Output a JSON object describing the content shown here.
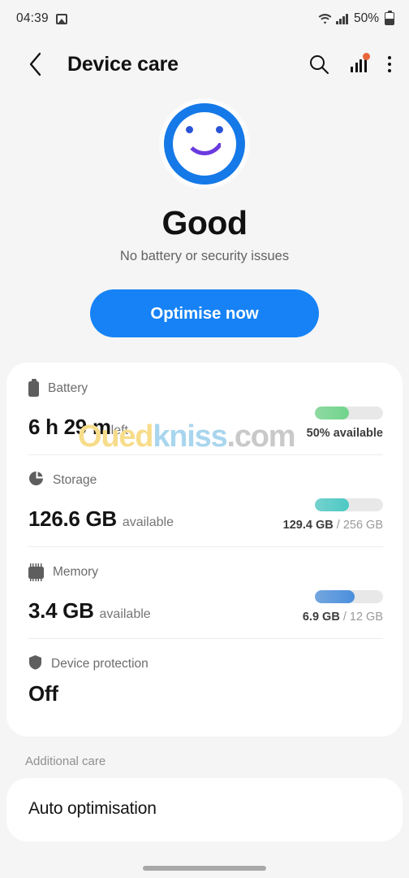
{
  "status_bar": {
    "time": "04:39",
    "image_icon": "image-icon",
    "wifi_icon": "wifi-icon",
    "signal_icon": "signal-icon",
    "battery_percent": "50%",
    "battery_icon": "battery-icon"
  },
  "app_bar": {
    "back_icon": "back-chevron-icon",
    "title": "Device care",
    "search_icon": "search-icon",
    "chart_icon": "bar-chart-icon",
    "chart_badge": "notification-badge-dot",
    "more_icon": "overflow-menu-icon"
  },
  "hero": {
    "face_icon": "smiley-face-icon",
    "title": "Good",
    "subtitle": "No battery or security issues",
    "button_label": "Optimise now",
    "button_color": "#1682f5",
    "face_ring_color": "#1579e8",
    "face_mouth_color": "#6a3ae0"
  },
  "metrics": [
    {
      "icon": "battery-icon",
      "label": "Battery",
      "value": "6 h 29 m",
      "unit": "left",
      "bar_percent": 50,
      "bar_color": "#6fd48a",
      "caption": "50% available",
      "caption_dim": ""
    },
    {
      "icon": "storage-pie-icon",
      "label": "Storage",
      "value": "126.6 GB",
      "unit": "available",
      "bar_percent": 50,
      "bar_color": "#4cc9c4",
      "caption": "129.4 GB",
      "caption_dim": " / 256 GB"
    },
    {
      "icon": "memory-chip-icon",
      "label": "Memory",
      "value": "3.4 GB",
      "unit": "available",
      "bar_percent": 58,
      "bar_color": "#4a8fdc",
      "caption": "6.9 GB",
      "caption_dim": " / 12 GB"
    },
    {
      "icon": "shield-icon",
      "label": "Device protection",
      "value": "Off",
      "unit": "",
      "bar_percent": 0,
      "bar_color": "",
      "caption": "",
      "caption_dim": ""
    }
  ],
  "additional_care": {
    "section_title": "Additional care",
    "items": [
      {
        "label": "Auto optimisation"
      }
    ]
  },
  "watermark": {
    "part1": "Oued",
    "part2": "kniss",
    "part3": ".com",
    "color1": "#f7dc8a",
    "color2": "#a9d6ee",
    "color3": "#c9c9c9"
  },
  "gesture_bar": "home-gesture-bar"
}
